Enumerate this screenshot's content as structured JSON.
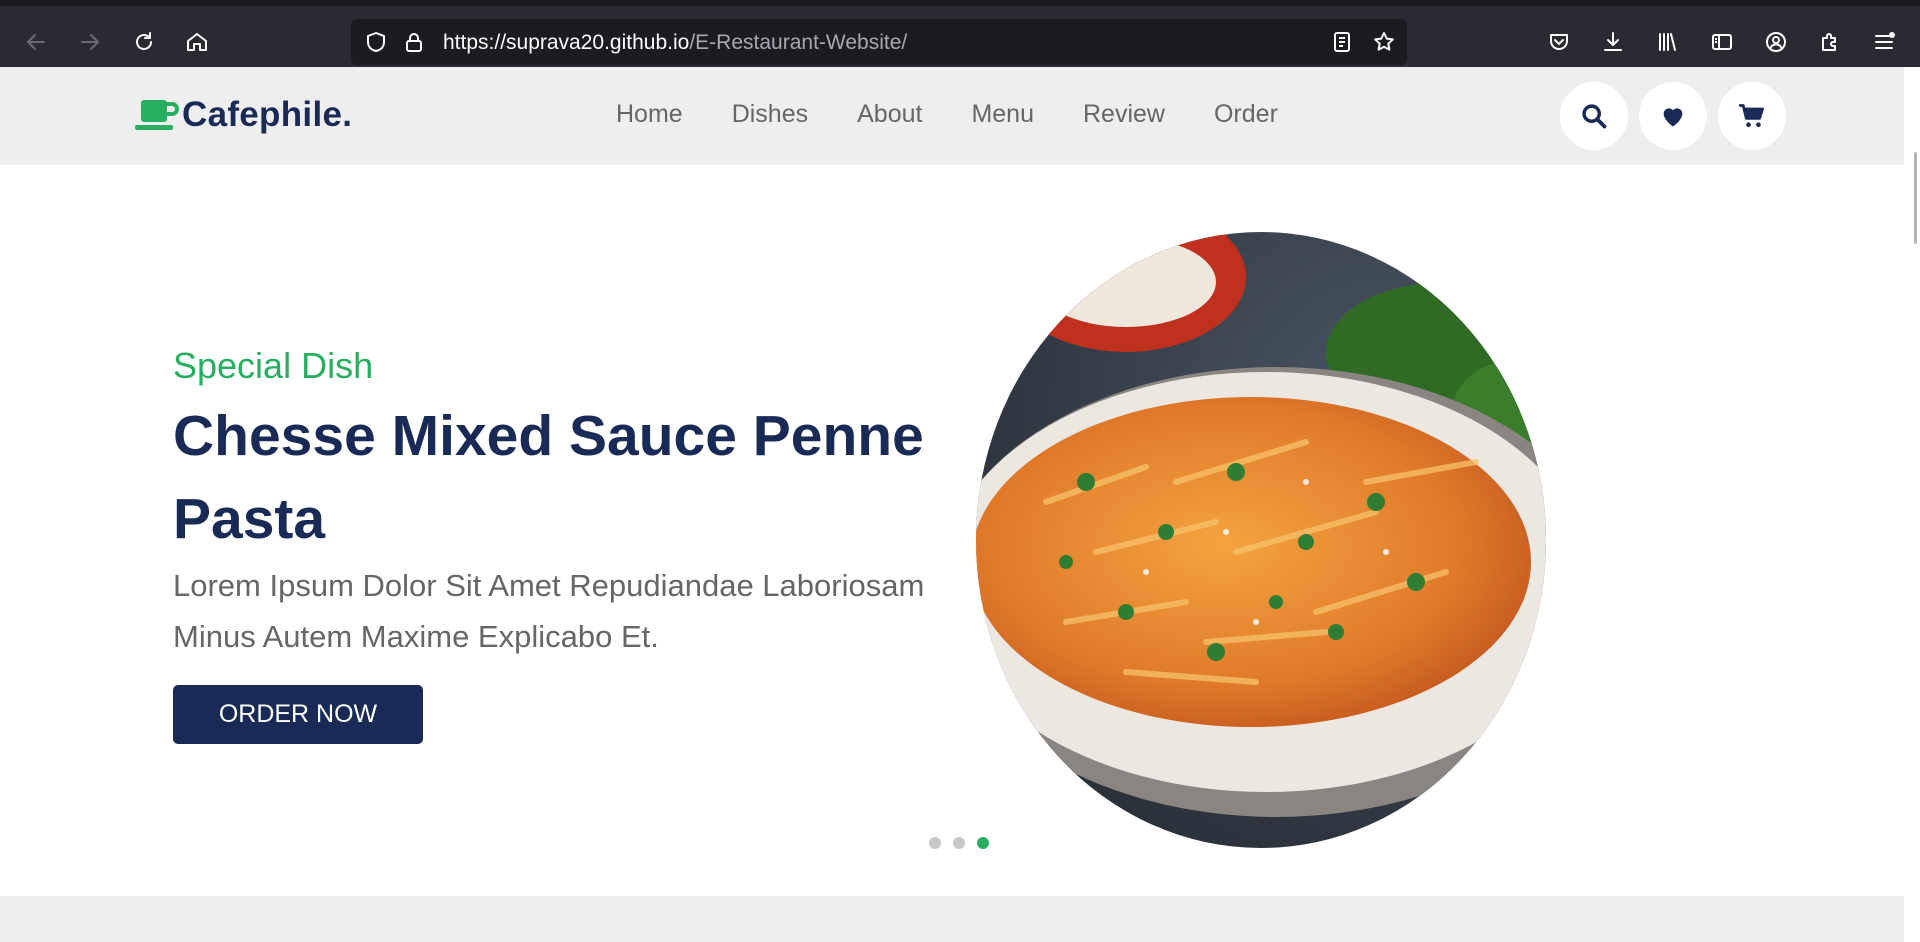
{
  "browser": {
    "url_host": "https://suprava20.github.io",
    "url_path": "/E-Restaurant-Website/"
  },
  "header": {
    "logo_text": "Cafephile.",
    "nav": [
      "Home",
      "Dishes",
      "About",
      "Menu",
      "Review",
      "Order"
    ],
    "icons": [
      "search-icon",
      "heart-icon",
      "cart-icon"
    ]
  },
  "hero": {
    "subtitle": "Special Dish",
    "title": "Chesse Mixed Sauce Penne Pasta",
    "description": "Lorem Ipsum Dolor Sit Amet Repudiandae Laboriosam Minus Autem Maxime Explicabo Et.",
    "button_label": "ORDER NOW",
    "slides_total": 3,
    "active_slide": 3
  },
  "colors": {
    "primary": "#192a56",
    "accent": "#27ae60",
    "text_muted": "#666666",
    "header_bg": "#eeeeee"
  }
}
